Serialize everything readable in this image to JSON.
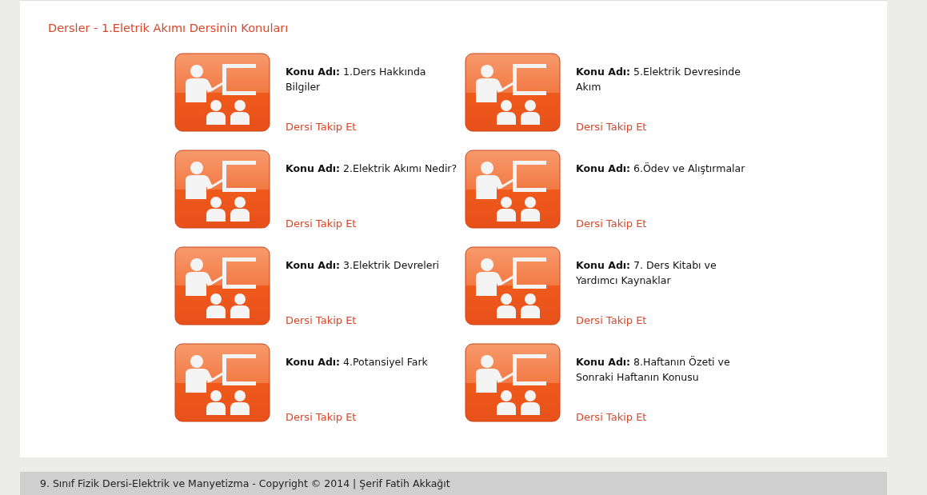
{
  "heading": "Dersler - 1.Eletrik Akımı Dersinin Konuları",
  "topics": [
    {
      "label": "Konu Adı:",
      "title": "1.Ders Hakkında Bilgiler",
      "link": "Dersi Takip Et"
    },
    {
      "label": "Konu Adı:",
      "title": "5.Elektrik Devresinde Akım",
      "link": "Dersi Takip Et"
    },
    {
      "label": "Konu Adı:",
      "title": "2.Elektrik Akımı Nedir?",
      "link": "Dersi Takip Et"
    },
    {
      "label": "Konu Adı:",
      "title": "6.Ödev ve Alıştırmalar",
      "link": "Dersi Takip Et"
    },
    {
      "label": "Konu Adı:",
      "title": "3.Elektrik Devreleri",
      "link": "Dersi Takip Et"
    },
    {
      "label": "Konu Adı:",
      "title": "7. Ders Kitabı ve Yardımcı Kaynaklar",
      "link": "Dersi Takip Et"
    },
    {
      "label": "Konu Adı:",
      "title": "4.Potansiyel Fark",
      "link": "Dersi Takip Et"
    },
    {
      "label": "Konu Adı:",
      "title": "8.Haftanın Özeti ve Sonraki Haftanın Konusu",
      "link": "Dersi Takip Et"
    }
  ],
  "footer": "9. Sınıf Fizik Dersi-Elektrik ve Manyetizma - Copyright © 2014 | Şerif Fatih Akkağıt"
}
